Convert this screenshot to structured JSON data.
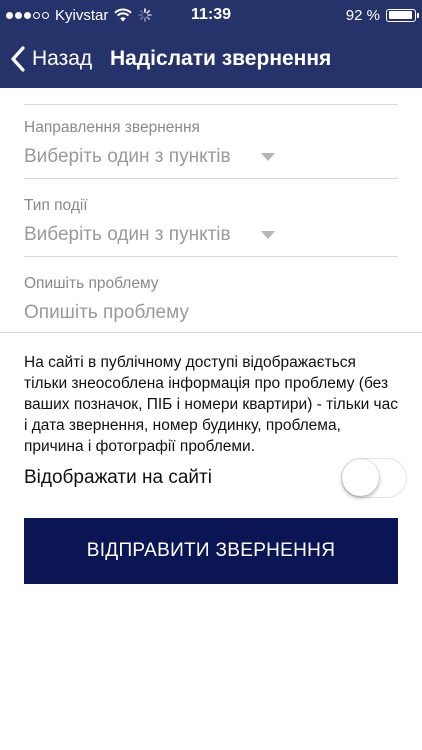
{
  "status_bar": {
    "carrier": "Kyivstar",
    "time": "11:39",
    "battery_percent": "92 %",
    "battery_level": 0.92,
    "signal_bars_filled": 3,
    "signal_bars_total": 5
  },
  "nav": {
    "back_label": "Назад",
    "title": "Надіслати звернення"
  },
  "form": {
    "direction": {
      "label": "Направлення звернення",
      "value": "Виберіть один з пунктів"
    },
    "event_type": {
      "label": "Тип події",
      "value": "Виберіть один з пунктів"
    },
    "description": {
      "label": "Опишіть проблему",
      "placeholder": "Опишіть проблему"
    }
  },
  "info_text": "На сайті в публічному доступі відображається тільки знеособлена інформація про проблему (без ваших позначок, ПІБ і номери квартири) - тільки час і дата звернення, номер будинку, проблема, причина і фотографії проблеми.",
  "toggle": {
    "label": "Відображати на сайті",
    "on": false
  },
  "submit_label": "ВІДПРАВИТИ ЗВЕРНЕННЯ",
  "colors": {
    "header_bg": "#26336a",
    "button_bg": "#0b1553",
    "placeholder": "#9a9a9a",
    "label": "#8a8a8a",
    "divider": "#d8d8d8"
  }
}
